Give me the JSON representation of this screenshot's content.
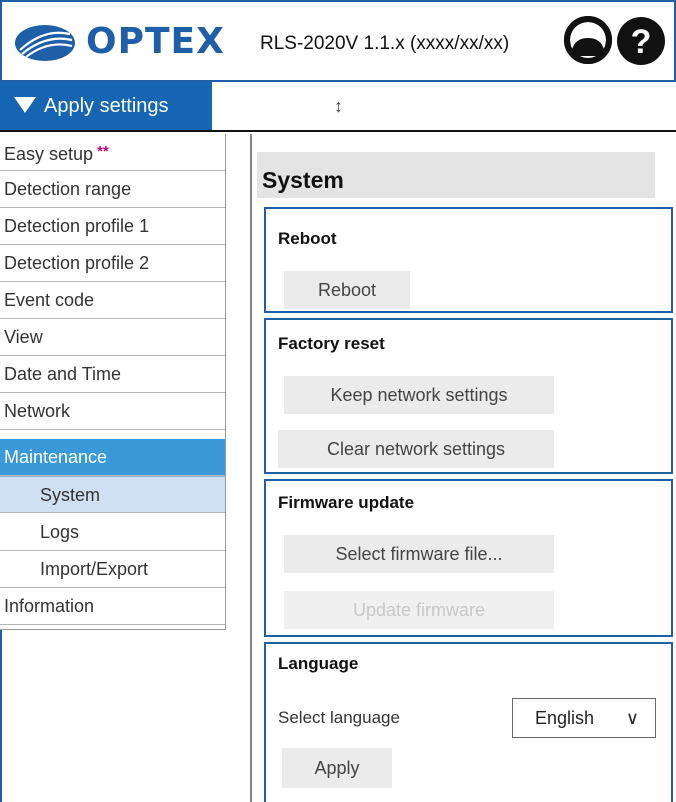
{
  "header": {
    "logo_text": "OPTEX",
    "version": "RLS-2020V 1.1.x (xxxx/xx/xx)",
    "user_icon": "user-icon",
    "help_icon": "help-icon",
    "brand_color": "#1f5fa8"
  },
  "toolbar": {
    "apply_label": "Apply settings",
    "resize_glyph": "↕"
  },
  "sidebar": {
    "items": [
      {
        "label": "Easy setup",
        "marker": "**"
      },
      {
        "label": "Detection range"
      },
      {
        "label": "Detection profile 1"
      },
      {
        "label": "Detection profile 2"
      },
      {
        "label": "Event code"
      },
      {
        "label": "View"
      },
      {
        "label": "Date and Time"
      },
      {
        "label": "Network"
      },
      {
        "label": "Maintenance"
      },
      {
        "label": "System"
      },
      {
        "label": "Logs"
      },
      {
        "label": "Import/Export"
      },
      {
        "label": "Information"
      }
    ],
    "active_color": "#3a9ad9",
    "selected_color": "#cfe0f3"
  },
  "main": {
    "section_title": "System",
    "reboot": {
      "title": "Reboot",
      "button": "Reboot"
    },
    "factory_reset": {
      "title": "Factory reset",
      "keep_button": "Keep network settings",
      "clear_button": "Clear network settings"
    },
    "firmware": {
      "title": "Firmware update",
      "select_button": "Select firmware file...",
      "update_button": "Update firmware"
    },
    "language": {
      "title": "Language",
      "label": "Select language",
      "selected": "English",
      "chevron": "∨",
      "apply_button": "Apply"
    }
  }
}
